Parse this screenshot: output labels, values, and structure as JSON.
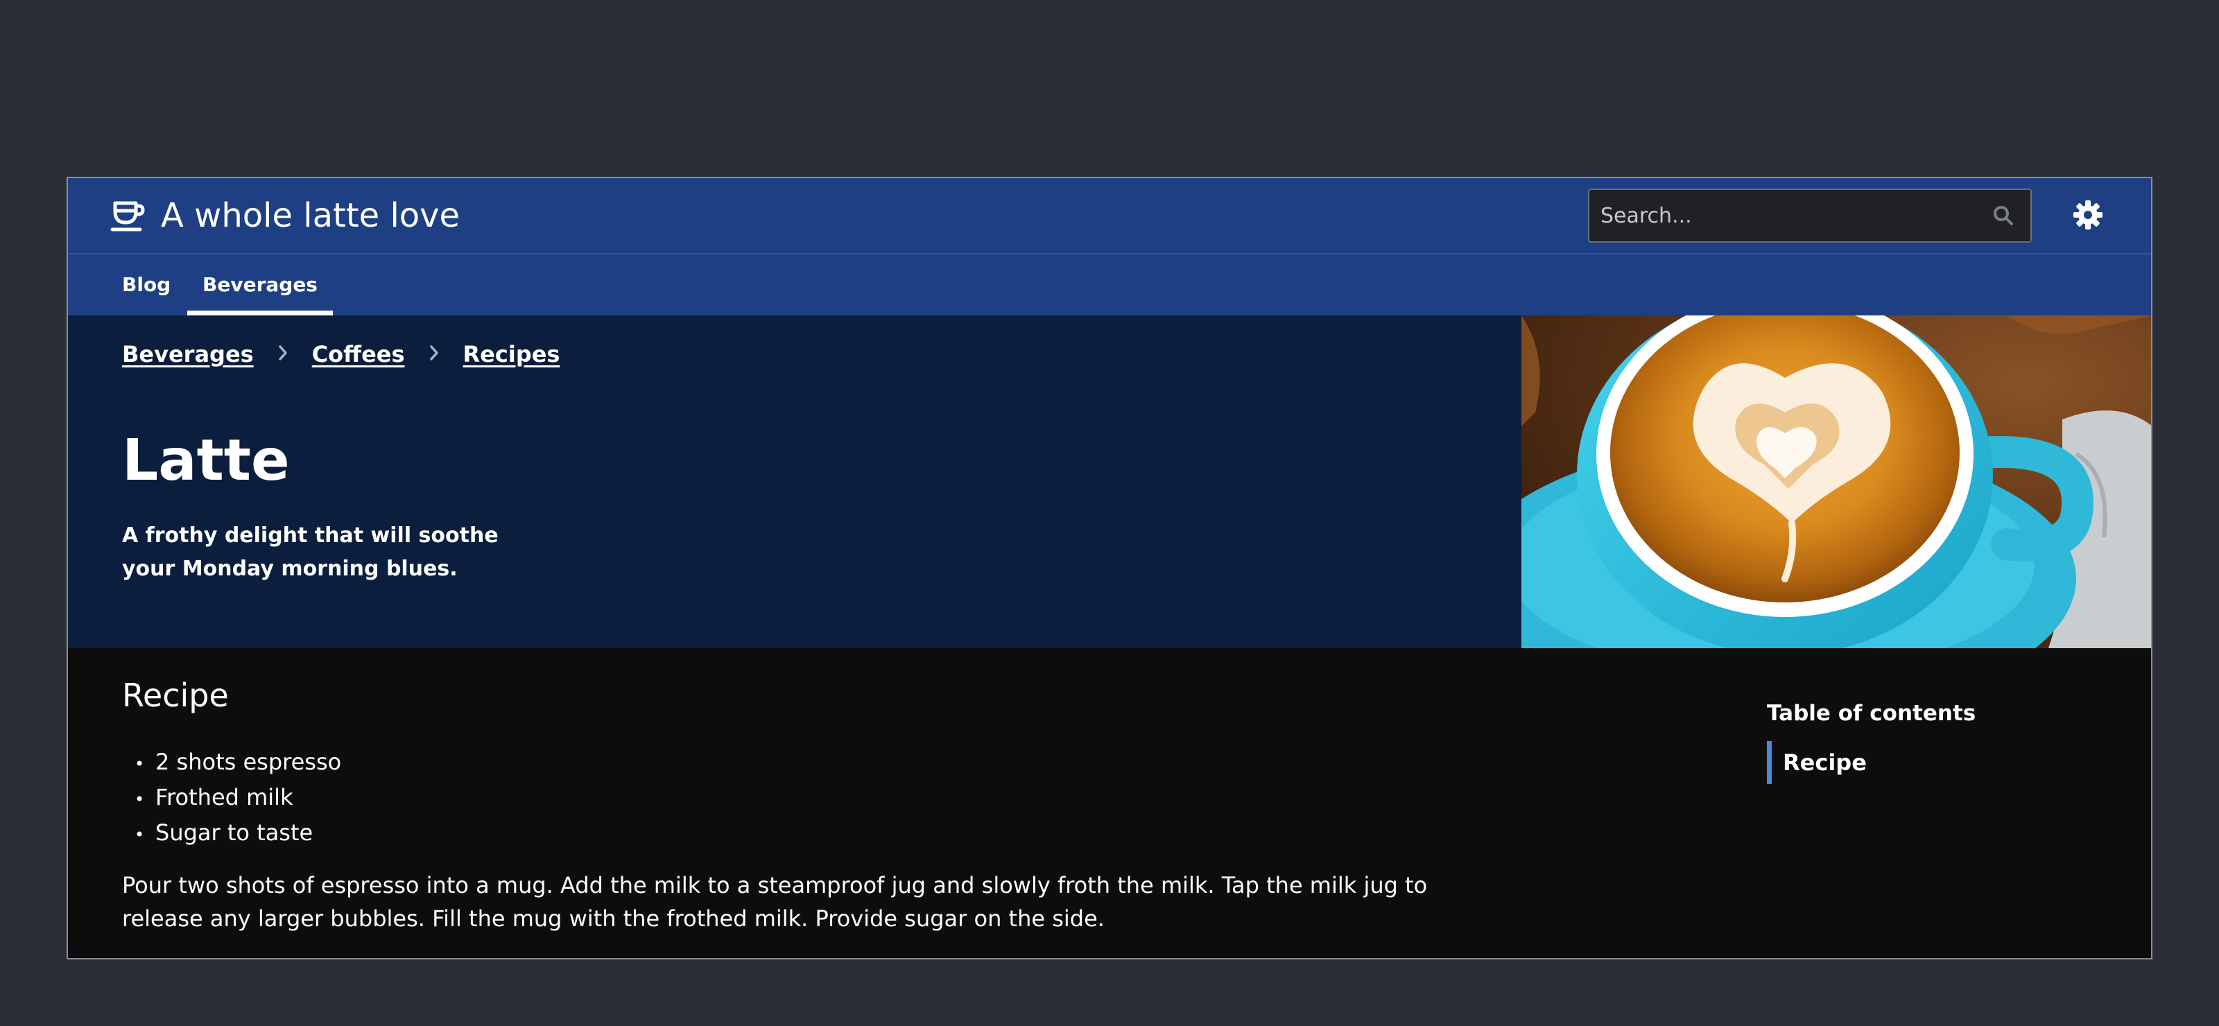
{
  "header": {
    "site_title": "A whole latte love",
    "logo_icon": "coffee-cup-icon",
    "search_placeholder": "Search...",
    "search_icon": "search-icon",
    "settings_icon": "gear-icon"
  },
  "nav": {
    "tabs": [
      {
        "label": "Blog",
        "active": false
      },
      {
        "label": "Beverages",
        "active": true
      }
    ]
  },
  "hero": {
    "breadcrumb": [
      "Beverages",
      "Coffees",
      "Recipes"
    ],
    "title": "Latte",
    "subtitle": "A frothy delight that will soothe your Monday morning blues.",
    "image_subject": "latte-art-cup"
  },
  "content": {
    "heading": "Recipe",
    "ingredients": [
      "2 shots espresso",
      "Frothed milk",
      "Sugar to taste"
    ],
    "instructions": "Pour two shots of espresso into a mug. Add the milk to a steamproof jug and slowly froth the milk. Tap the milk jug to release any larger bubbles. Fill the mug with the frothed milk. Provide sugar on the side."
  },
  "toc": {
    "title": "Table of contents",
    "items": [
      {
        "label": "Recipe",
        "active": true
      }
    ]
  },
  "colors": {
    "page_background": "#2b2e36",
    "header_blue": "#1e3f84",
    "hero_navy": "#0b1e3d",
    "content_background": "#0d0d0d",
    "toc_accent": "#4a8ae0"
  }
}
